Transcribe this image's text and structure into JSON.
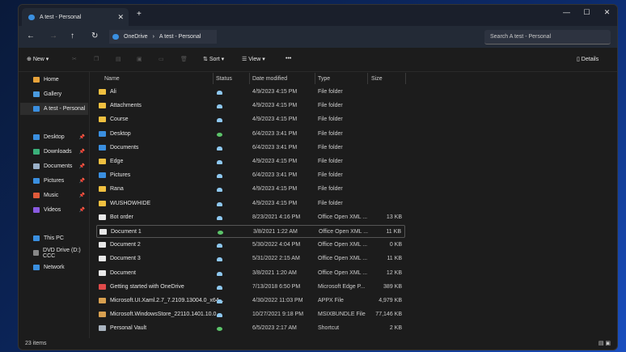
{
  "window": {
    "tab_title": "A test - Personal",
    "new_tab": "+",
    "controls": [
      "—",
      "☐",
      "✕"
    ]
  },
  "address": {
    "back": "←",
    "forward": "→",
    "up": "↑",
    "refresh": "↻",
    "crumbs": [
      "OneDrive",
      "A test - Personal"
    ],
    "search_placeholder": "Search A test - Personal"
  },
  "toolbar": {
    "new": "New",
    "sort": "Sort",
    "view": "View",
    "more": "•••",
    "details": "Details"
  },
  "sidebar": {
    "items": [
      {
        "label": "Home",
        "color": "#e8a33a"
      },
      {
        "label": "Gallery",
        "color": "#4a9be0"
      },
      {
        "label": "A test - Personal",
        "color": "#3a8fe0",
        "selected": true
      },
      {
        "label": "Desktop",
        "color": "#3a8fe0",
        "pinned": true
      },
      {
        "label": "Downloads",
        "color": "#3ab07a",
        "pinned": true
      },
      {
        "label": "Documents",
        "color": "#9ab0c8",
        "pinned": true
      },
      {
        "label": "Pictures",
        "color": "#3a8fe0",
        "pinned": true
      },
      {
        "label": "Music",
        "color": "#e05a3a",
        "pinned": true
      },
      {
        "label": "Videos",
        "color": "#8a5ae0",
        "pinned": true
      },
      {
        "label": "This PC",
        "color": "#3a8fe0"
      },
      {
        "label": "DVD Drive (D:) CCC",
        "color": "#888"
      },
      {
        "label": "Network",
        "color": "#3a8fe0"
      }
    ]
  },
  "columns": {
    "name": "Name",
    "status": "Status",
    "date": "Date modified",
    "type": "Type",
    "size": "Size"
  },
  "files": [
    {
      "name": "Ali",
      "status": "cloud",
      "date": "4/9/2023 4:15 PM",
      "type": "File folder",
      "size": "",
      "kind": "folder"
    },
    {
      "name": "Attachments",
      "status": "cloud",
      "date": "4/9/2023 4:15 PM",
      "type": "File folder",
      "size": "",
      "kind": "folder"
    },
    {
      "name": "Course",
      "status": "cloud",
      "date": "4/9/2023 4:15 PM",
      "type": "File folder",
      "size": "",
      "kind": "folder"
    },
    {
      "name": "Desktop",
      "status": "synced",
      "date": "6/4/2023 3:41 PM",
      "type": "File folder",
      "size": "",
      "kind": "special"
    },
    {
      "name": "Documents",
      "status": "cloud",
      "date": "6/4/2023 3:41 PM",
      "type": "File folder",
      "size": "",
      "kind": "special"
    },
    {
      "name": "Edge",
      "status": "cloud",
      "date": "4/9/2023 4:15 PM",
      "type": "File folder",
      "size": "",
      "kind": "folder"
    },
    {
      "name": "Pictures",
      "status": "cloud",
      "date": "6/4/2023 3:41 PM",
      "type": "File folder",
      "size": "",
      "kind": "special"
    },
    {
      "name": "Rana",
      "status": "cloud",
      "date": "4/9/2023 4:15 PM",
      "type": "File folder",
      "size": "",
      "kind": "folder"
    },
    {
      "name": "WUSHOWHIDE",
      "status": "cloud",
      "date": "4/9/2023 4:15 PM",
      "type": "File folder",
      "size": "",
      "kind": "folder"
    },
    {
      "name": "Bot order",
      "status": "cloud",
      "date": "8/23/2021 4:16 PM",
      "type": "Office Open XML ...",
      "size": "13 KB",
      "kind": "doc"
    },
    {
      "name": "Document 1",
      "status": "synced",
      "date": "3/8/2021 1:22 AM",
      "type": "Office Open XML ...",
      "size": "11 KB",
      "kind": "doc",
      "focused": true
    },
    {
      "name": "Document 2",
      "status": "cloud",
      "date": "5/30/2022 4:04 PM",
      "type": "Office Open XML ...",
      "size": "0 KB",
      "kind": "doc"
    },
    {
      "name": "Document 3",
      "status": "cloud",
      "date": "5/31/2022 2:15 AM",
      "type": "Office Open XML ...",
      "size": "11 KB",
      "kind": "doc"
    },
    {
      "name": "Document",
      "status": "cloud",
      "date": "3/8/2021 1:20 AM",
      "type": "Office Open XML ...",
      "size": "12 KB",
      "kind": "doc"
    },
    {
      "name": "Getting started with OneDrive",
      "status": "cloud",
      "date": "7/13/2018 6:50 PM",
      "type": "Microsoft Edge P...",
      "size": "389 KB",
      "kind": "pdf"
    },
    {
      "name": "Microsoft.UI.Xaml.2.7_7.2109.13004.0_x64...",
      "status": "cloud",
      "date": "4/30/2022 11:03 PM",
      "type": "APPX File",
      "size": "4,979 KB",
      "kind": "pkg"
    },
    {
      "name": "Microsoft.WindowsStore_22110.1401.10.0...",
      "status": "cloud",
      "date": "10/27/2021 9:18 PM",
      "type": "MSIXBUNDLE File",
      "size": "77,146 KB",
      "kind": "pkg"
    },
    {
      "name": "Personal Vault",
      "status": "synced",
      "date": "6/5/2023 2:17 AM",
      "type": "Shortcut",
      "size": "2 KB",
      "kind": "vault"
    }
  ],
  "statusbar": {
    "count": "23 items"
  },
  "colors": {
    "folder": "#f0c040",
    "special": "#3a8fe0",
    "doc": "#e8e8e8",
    "pdf": "#e04a4a",
    "pkg": "#d8a050",
    "vault": "#aab4c0",
    "cloud": "#8ec8f0",
    "synced": "#5cc46a"
  }
}
